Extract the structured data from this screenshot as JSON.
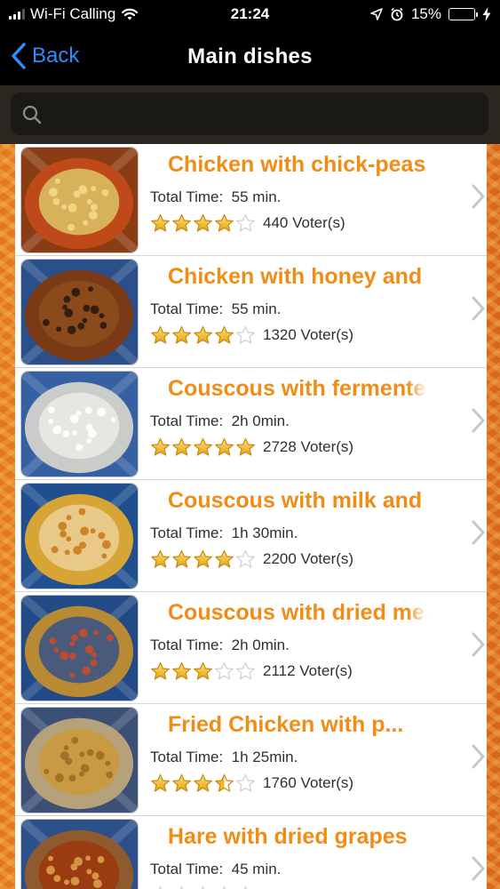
{
  "status_bar": {
    "carrier": "Wi-Fi Calling",
    "time": "21:24",
    "battery": "15%",
    "battery_level": 0.15
  },
  "nav": {
    "back_label": "Back",
    "title": "Main dishes"
  },
  "search": {
    "placeholder": ""
  },
  "colors": {
    "accent": "#2e8cff",
    "title": "#f08d16",
    "star_filled": "#f2b622",
    "star_empty": "#cfcfcf"
  },
  "labels": {
    "total_time": "Total Time:"
  },
  "recipes": [
    {
      "title": "Chicken with chick-peas",
      "time": "55 min.",
      "rating": 4,
      "voters": "440 Voter(s)"
    },
    {
      "title": "Chicken with honey and",
      "time": "55 min.",
      "rating": 4,
      "voters": "1320 Voter(s)"
    },
    {
      "title": "Couscous with fermented",
      "time": "2h 0min.",
      "rating": 5,
      "voters": "2728 Voter(s)"
    },
    {
      "title": "Couscous with milk and",
      "time": "1h 30min.",
      "rating": 4,
      "voters": "2200 Voter(s)"
    },
    {
      "title": "Couscous with dried meat",
      "time": "2h 0min.",
      "rating": 3,
      "voters": "2112 Voter(s)"
    },
    {
      "title": "Fried Chicken with p...",
      "time": "1h 25min.",
      "rating": 3.5,
      "voters": "1760 Voter(s)"
    },
    {
      "title": "Hare with dried grapes",
      "time": "45 min.",
      "rating": 0,
      "voters": ""
    }
  ]
}
